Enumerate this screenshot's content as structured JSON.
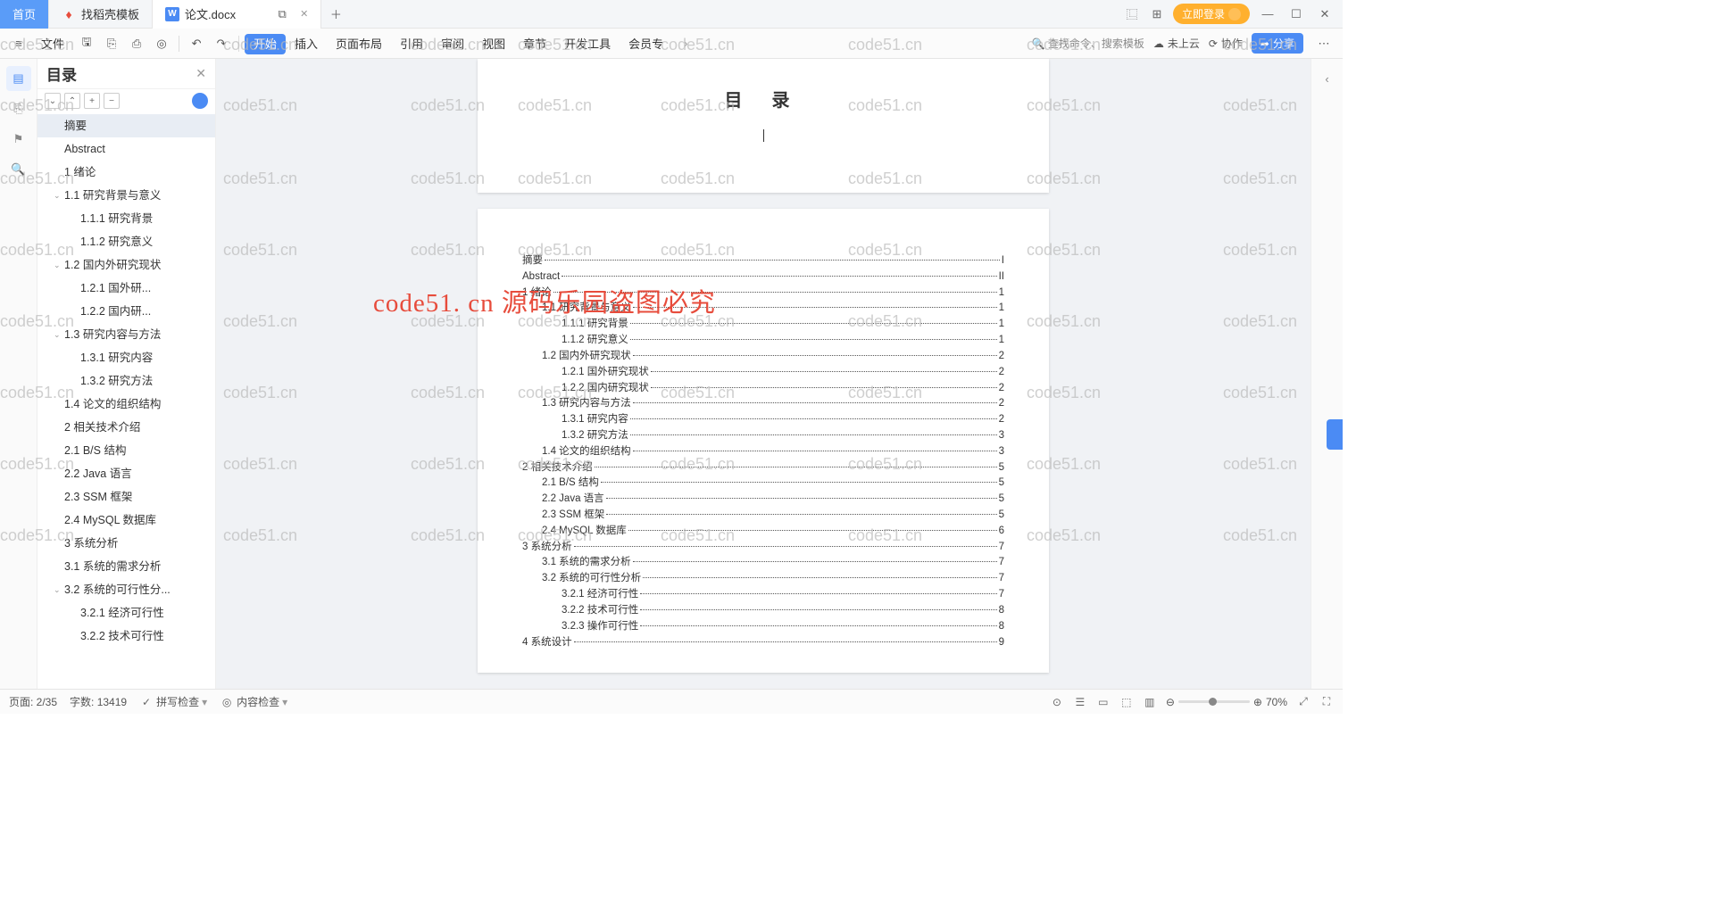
{
  "tabs": {
    "home": "首页",
    "tpl": "找稻壳模板",
    "doc": "论文.docx"
  },
  "login": "立即登录",
  "file_label": "文件",
  "menus": [
    "开始",
    "插入",
    "页面布局",
    "引用",
    "审阅",
    "视图",
    "章节",
    "开发工具",
    "会员专"
  ],
  "search_placeholder": "查找命令、搜索模板",
  "cloud_off": "未上云",
  "collab": "协作",
  "share": "分享",
  "outline_title": "目录",
  "outline": [
    {
      "t": "摘要",
      "lvl": 0,
      "sel": true
    },
    {
      "t": "Abstract",
      "lvl": 0
    },
    {
      "t": "1 绪论",
      "lvl": 0
    },
    {
      "t": "1.1 研究背景与意义",
      "lvl": 1,
      "ex": true
    },
    {
      "t": "1.1.1 研究背景",
      "lvl": 2
    },
    {
      "t": "1.1.2 研究意义",
      "lvl": 2
    },
    {
      "t": "1.2 国内外研究现状",
      "lvl": 1,
      "ex": true
    },
    {
      "t": "1.2.1 国外研...",
      "lvl": 2
    },
    {
      "t": "1.2.2 国内研...",
      "lvl": 2
    },
    {
      "t": "1.3 研究内容与方法",
      "lvl": 1,
      "ex": true
    },
    {
      "t": "1.3.1 研究内容",
      "lvl": 2
    },
    {
      "t": "1.3.2 研究方法",
      "lvl": 2
    },
    {
      "t": "1.4 论文的组织结构",
      "lvl": 1
    },
    {
      "t": "2 相关技术介绍",
      "lvl": 0
    },
    {
      "t": "2.1 B/S 结构",
      "lvl": 1
    },
    {
      "t": "2.2 Java 语言",
      "lvl": 1
    },
    {
      "t": "2.3 SSM 框架",
      "lvl": 1
    },
    {
      "t": "2.4 MySQL 数据库",
      "lvl": 1
    },
    {
      "t": "3 系统分析",
      "lvl": 0
    },
    {
      "t": "3.1 系统的需求分析",
      "lvl": 1
    },
    {
      "t": "3.2 系统的可行性分...",
      "lvl": 1,
      "ex": true
    },
    {
      "t": "3.2.1 经济可行性",
      "lvl": 2
    },
    {
      "t": "3.2.2 技术可行性",
      "lvl": 2
    }
  ],
  "doc_title": "目 录",
  "toc": [
    {
      "t": "摘要",
      "p": "I",
      "l": 1
    },
    {
      "t": "Abstract",
      "p": "II",
      "l": 1
    },
    {
      "t": "1 绪论",
      "p": "1",
      "l": 1
    },
    {
      "t": "1.1 研究背景与意义",
      "p": "1",
      "l": 2
    },
    {
      "t": "1.1.1 研究背景",
      "p": "1",
      "l": 3
    },
    {
      "t": "1.1.2 研究意义",
      "p": "1",
      "l": 3
    },
    {
      "t": "1.2 国内外研究现状",
      "p": "2",
      "l": 2
    },
    {
      "t": "1.2.1 国外研究现状",
      "p": "2",
      "l": 3
    },
    {
      "t": "1.2.2 国内研究现状",
      "p": "2",
      "l": 3
    },
    {
      "t": "1.3 研究内容与方法",
      "p": "2",
      "l": 2
    },
    {
      "t": "1.3.1 研究内容",
      "p": "2",
      "l": 3
    },
    {
      "t": "1.3.2 研究方法",
      "p": "3",
      "l": 3
    },
    {
      "t": "1.4 论文的组织结构",
      "p": "3",
      "l": 2
    },
    {
      "t": "2 相关技术介绍",
      "p": "5",
      "l": 1
    },
    {
      "t": "2.1 B/S 结构",
      "p": "5",
      "l": 2
    },
    {
      "t": "2.2 Java 语言",
      "p": "5",
      "l": 2
    },
    {
      "t": "2.3 SSM 框架",
      "p": "5",
      "l": 2
    },
    {
      "t": "2.4 MySQL 数据库",
      "p": "6",
      "l": 2
    },
    {
      "t": "3 系统分析",
      "p": "7",
      "l": 1
    },
    {
      "t": "3.1 系统的需求分析",
      "p": "7",
      "l": 2
    },
    {
      "t": "3.2 系统的可行性分析",
      "p": "7",
      "l": 2
    },
    {
      "t": "3.2.1 经济可行性",
      "p": "7",
      "l": 3
    },
    {
      "t": "3.2.2 技术可行性",
      "p": "8",
      "l": 3
    },
    {
      "t": "3.2.3 操作可行性",
      "p": "8",
      "l": 3
    },
    {
      "t": "4 系统设计",
      "p": "9",
      "l": 1
    }
  ],
  "status": {
    "page": "页面: 2/35",
    "words": "字数: 13419",
    "spell": "拼写检查",
    "content": "内容检查",
    "zoom": "70%"
  },
  "watermark_text": "code51.cn",
  "banner": "code51. cn  源码乐园盗图必究"
}
